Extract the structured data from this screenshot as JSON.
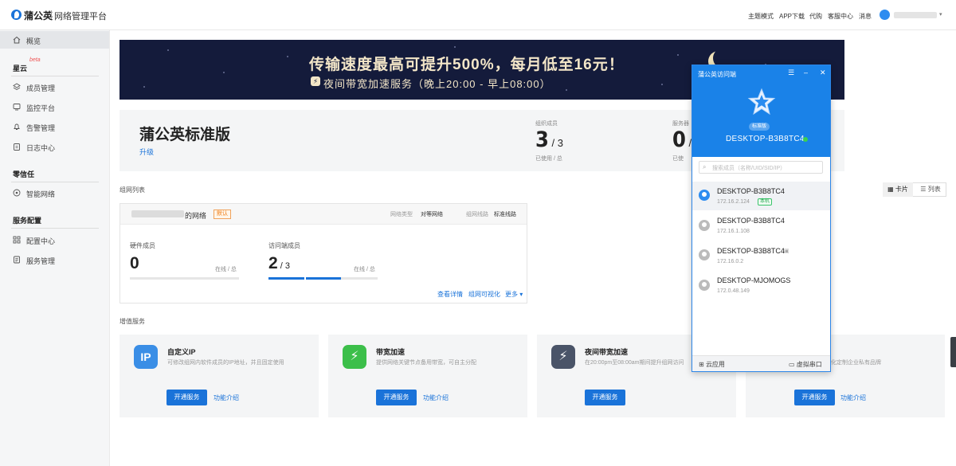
{
  "header": {
    "logo": "蒲公英",
    "subtitle": "网络管理平台",
    "nav": [
      "主题模式",
      "APP下载",
      "代购",
      "客服中心",
      "消息"
    ]
  },
  "sidebar": {
    "overview": "概览",
    "section_xingyun": "星云",
    "beta": "beta",
    "items_xingyun": [
      "成员管理",
      "监控平台",
      "告警管理",
      "日志中心"
    ],
    "section_zero": "零信任",
    "items_zero": [
      "智能网络"
    ],
    "section_svc": "服务配置",
    "items_svc": [
      "配置中心",
      "服务管理"
    ]
  },
  "banner": {
    "line1": "传输速度最高可提升500%，每月低至16元！",
    "icon": "⚡",
    "line2": "夜间带宽加速服务（晚上20:00 - 早上08:00）"
  },
  "plan": {
    "name": "蒲公英标准版",
    "upgrade": "升级",
    "stat1_label": "组织成员",
    "stat1_value": "3",
    "stat1_total": "3",
    "stat1_sub": "已使用 / 总",
    "stat2_label": "服务器",
    "stat2_value": "0",
    "stat2_sub": "已使"
  },
  "groups": {
    "title": "组网列表",
    "view_card": "卡片",
    "view_list": "列表"
  },
  "network": {
    "name_suffix": "的网络",
    "default_tag": "默认",
    "type_label": "网络类型",
    "type_value": "对等网络",
    "line_label": "组网线路",
    "line_value": "标准线路",
    "hw_label": "硬件成员",
    "hw_value": "0",
    "hw_right": "在线 / 总",
    "hw_progress": 0,
    "client_label": "访问端成员",
    "client_value": "2",
    "client_total": "3",
    "client_right": "在线 / 总",
    "client_progress": 0.667,
    "links": [
      "查看详情",
      "组网可视化",
      "更多 ▾"
    ]
  },
  "services": {
    "title": "增值服务",
    "cards": [
      {
        "icon": "IP",
        "title": "自定义IP",
        "desc": "可修改组网内软件成员的IP地址，并且固定使用",
        "btn": "开通服务",
        "link": "功能介绍",
        "color": "#3a8ee6"
      },
      {
        "icon": "⚡",
        "title": "带宽加速",
        "desc": "提供网络关键节点备用带宽，可自主分配",
        "btn": "开通服务",
        "link": "功能介绍",
        "color": "#3cbf4a"
      },
      {
        "icon": "⚡",
        "title": "夜间带宽加速",
        "desc": "在20:00pm至08:00am期间提升组网访问",
        "btn": "开通服务",
        "link": "",
        "color": "#4a5468"
      },
      {
        "icon": "",
        "title": "",
        "desc": "化定制企业私有品牌",
        "btn": "开通服务",
        "link": "功能介绍",
        "color": "#f4f5f6"
      }
    ]
  },
  "popup": {
    "title": "蒲公英访问端",
    "edition": "标准版",
    "device": "DESKTOP-B3B8TC4",
    "search_placeholder": "搜索成员（名称/UID/SID/IP）",
    "members": [
      {
        "name": "DESKTOP-B3B8TC4",
        "ip": "172.16.2.124",
        "tag": "本机",
        "me": true
      },
      {
        "name": "DESKTOP-B3B8TC4",
        "ip": "172.16.1.108",
        "tag": "",
        "me": false
      },
      {
        "name": "DESKTOP-B3B8TC4",
        "ip": "172.16.0.2",
        "tag": "",
        "me": false
      },
      {
        "name": "DESKTOP-MJOMOGS",
        "ip": "172.0.48.149",
        "tag": "",
        "me": false
      }
    ],
    "footer_left": "云应用",
    "footer_right": "虚拟串口"
  }
}
